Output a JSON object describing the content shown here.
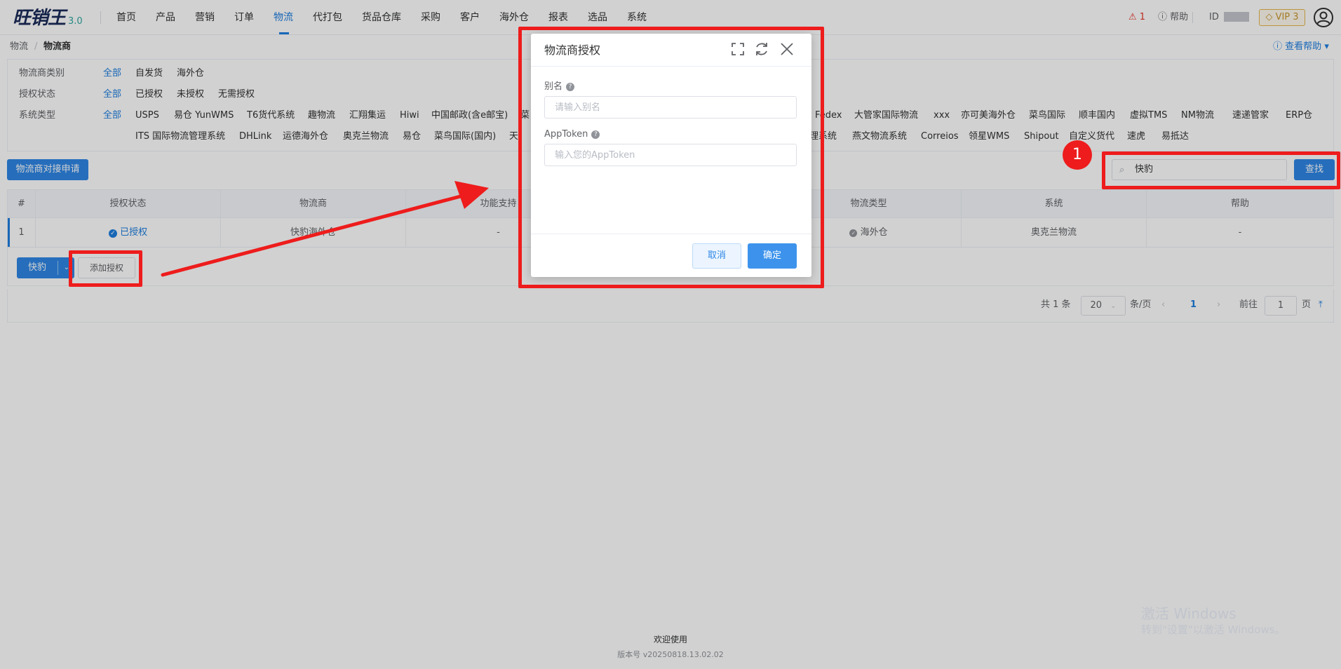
{
  "header": {
    "logo_text": "旺销王",
    "logo_version": "3.0",
    "nav": [
      "首页",
      "产品",
      "营销",
      "订单",
      "物流",
      "代打包",
      "货品仓库",
      "采购",
      "客户",
      "海外仓",
      "报表",
      "选品",
      "系统"
    ],
    "active_nav": "物流",
    "alert_count": "1",
    "help_label": "帮助",
    "id_label": "ID",
    "vip_label": "VIP 3"
  },
  "breadcrumb": {
    "parent": "物流",
    "separator": "/",
    "current": "物流商",
    "help_link": "查看帮助"
  },
  "filters": {
    "category": {
      "label": "物流商类别",
      "options": [
        "全部",
        "自发货",
        "海外仓"
      ]
    },
    "auth_status": {
      "label": "授权状态",
      "options": [
        "全部",
        "已授权",
        "未授权",
        "无需授权"
      ]
    },
    "system_type": {
      "label": "系统类型",
      "all": "全部",
      "row1_left": [
        "USPS",
        "易仓 YunWMS",
        "T6货代系统",
        "趣物流",
        "汇翔集运",
        "Hiwi",
        "中国邮政(含e邮宝)",
        "菜"
      ],
      "row1_right": [
        "Fedex",
        "大管家国际物流",
        "xxx",
        "亦可美海外仓",
        "菜鸟国际",
        "顺丰国内",
        "虚拟TMS",
        "NM物流",
        "速递管家",
        "ERP仓"
      ],
      "row2_left": [
        "ITS 国际物流管理系统",
        "DHLink",
        "运德海外仓",
        "奥克兰物流",
        "易仓",
        "菜鸟国际(国内)",
        "天"
      ],
      "row2_right": [
        "理系统",
        "燕文物流系统",
        "Correios",
        "领星WMS",
        "Shipout",
        "自定义货代",
        "速虎",
        "易抵达"
      ]
    }
  },
  "toolbar": {
    "apply_button": "物流商对接申请",
    "search_value": "快豹",
    "search_button": "查找"
  },
  "table": {
    "headers": [
      "#",
      "授权状态",
      "物流商",
      "功能支持",
      "物流类型",
      "系统",
      "帮助"
    ],
    "row": {
      "index": "1",
      "status": "已授权",
      "carrier": "快豹海外仓",
      "features": "-",
      "logistics_type": "海外仓",
      "system": "奥克兰物流",
      "help": "-"
    },
    "split_button": "快豹",
    "add_auth_button": "添加授权"
  },
  "pagination": {
    "total": "共 1 条",
    "page_size": "20",
    "per_page_label": "条/页",
    "current_page": "1",
    "goto_label": "前往",
    "goto_value": "1",
    "page_unit": "页"
  },
  "footer": {
    "welcome": "欢迎使用",
    "version": "版本号 v20250818.13.02.02"
  },
  "watermark": {
    "line1": "激活 Windows",
    "line2": "转到\"设置\"以激活 Windows。"
  },
  "dialog": {
    "title": "物流商授权",
    "alias_label": "别名",
    "alias_placeholder": "请输入别名",
    "token_label": "AppToken",
    "token_placeholder": "输入您的AppToken",
    "cancel": "取消",
    "confirm": "确定"
  },
  "annotation": {
    "badge": "1",
    "color": "#ee1c1c"
  }
}
